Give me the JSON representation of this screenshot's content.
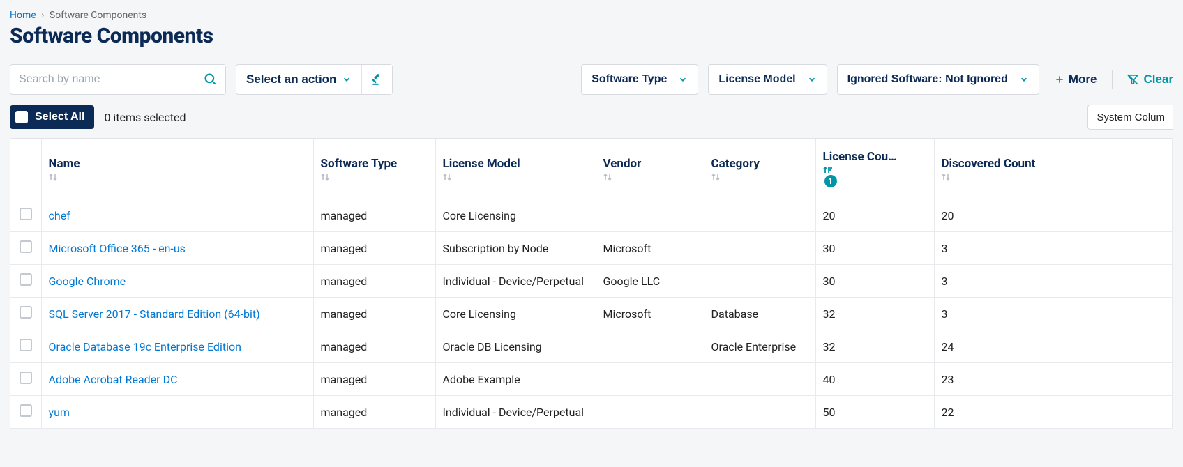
{
  "breadcrumb": {
    "home": "Home",
    "sep": "›",
    "current": "Software Components"
  },
  "title": "Software Components",
  "search": {
    "placeholder": "Search by name"
  },
  "action": {
    "label": "Select an action"
  },
  "filters": {
    "software_type": "Software Type",
    "license_model": "License Model",
    "ignored": "Ignored Software: Not Ignored",
    "more": "More",
    "clear": "Clear"
  },
  "selectbar": {
    "select_all": "Select All",
    "items_selected": "0 items selected"
  },
  "syscol": "System Colum",
  "columns": {
    "name": "Name",
    "software_type": "Software Type",
    "license_model": "License Model",
    "vendor": "Vendor",
    "category": "Category",
    "license_count": "License Cou…",
    "discovered_count": "Discovered Count",
    "license_count_badge": "1"
  },
  "rows": [
    {
      "name": "chef",
      "software_type": "managed",
      "license_model": "Core Licensing",
      "vendor": "",
      "category": "",
      "license_count": "20",
      "discovered_count": "20"
    },
    {
      "name": "Microsoft Office 365 - en-us",
      "software_type": "managed",
      "license_model": "Subscription by Node",
      "vendor": "Microsoft",
      "category": "",
      "license_count": "30",
      "discovered_count": "3"
    },
    {
      "name": "Google Chrome",
      "software_type": "managed",
      "license_model": "Individual - Device/Perpetual",
      "vendor": "Google LLC",
      "category": "",
      "license_count": "30",
      "discovered_count": "3"
    },
    {
      "name": "SQL Server 2017 - Standard Edition (64-bit)",
      "software_type": "managed",
      "license_model": "Core Licensing",
      "vendor": "Microsoft",
      "category": "Database",
      "license_count": "32",
      "discovered_count": "3"
    },
    {
      "name": "Oracle Database 19c Enterprise Edition",
      "software_type": "managed",
      "license_model": "Oracle DB Licensing",
      "vendor": "",
      "category": "Oracle Enterprise",
      "license_count": "32",
      "discovered_count": "24"
    },
    {
      "name": "Adobe Acrobat Reader DC",
      "software_type": "managed",
      "license_model": "Adobe Example",
      "vendor": "",
      "category": "",
      "license_count": "40",
      "discovered_count": "23"
    },
    {
      "name": "yum",
      "software_type": "managed",
      "license_model": "Individual - Device/Perpetual",
      "vendor": "",
      "category": "",
      "license_count": "50",
      "discovered_count": "22"
    }
  ]
}
